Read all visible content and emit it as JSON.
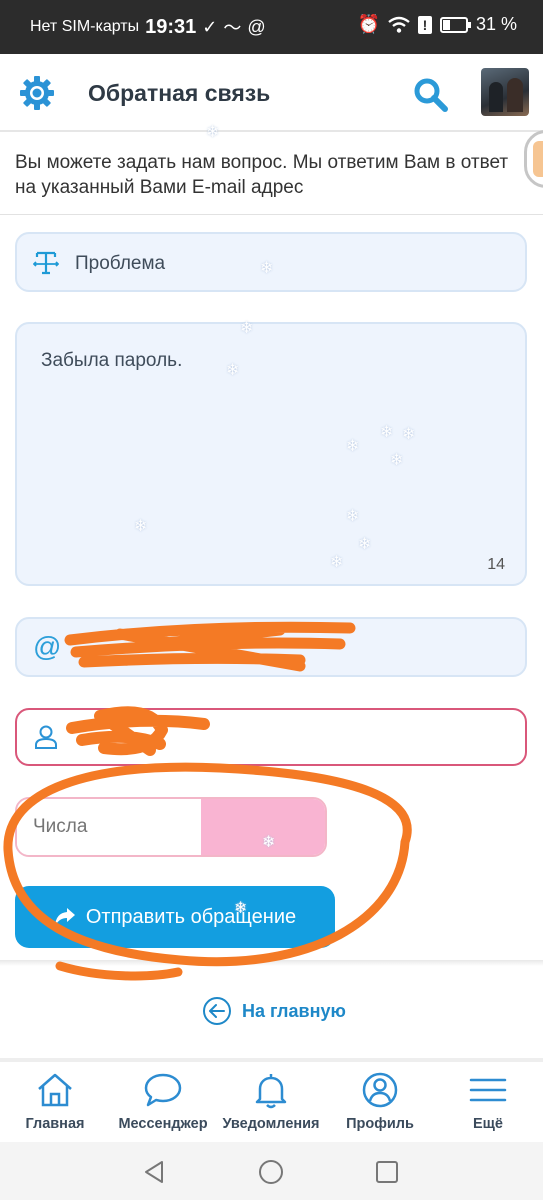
{
  "status_bar": {
    "carrier": "Нет SIM-карты",
    "time": "19:31",
    "indicators": [
      "check-icon",
      "tilde-icon",
      "at-icon"
    ],
    "right_icons": [
      "alarm-icon",
      "wifi-icon",
      "alert-icon"
    ],
    "battery": "31 %"
  },
  "header": {
    "title": "Обратная связь",
    "left_icon": "gear-icon",
    "search_icon": "search-icon",
    "avatar_icon": "avatar"
  },
  "intro": {
    "text": "Вы можете задать нам вопрос. Мы ответим Вам в ответ на указанный Вами E-mail адрес"
  },
  "form": {
    "subject": {
      "icon": "text-cursor-icon",
      "value": "Проблема"
    },
    "message": {
      "value": "Забыла пароль.",
      "count": "14"
    },
    "email": {
      "icon": "at-icon",
      "value": ""
    },
    "name": {
      "icon": "user-icon",
      "value": ""
    },
    "captcha": {
      "placeholder": "Числа"
    },
    "submit": {
      "label": "Отправить обращение",
      "icon": "share-arrow-icon"
    }
  },
  "home_link": {
    "label": "На главную",
    "icon": "arrow-left-circle-icon"
  },
  "bottom_nav": {
    "items": [
      {
        "label": "Главная",
        "icon": "home-icon"
      },
      {
        "label": "Мессенджер",
        "icon": "chat-bubble-icon"
      },
      {
        "label": "Уведомления",
        "icon": "bell-icon"
      },
      {
        "label": "Профиль",
        "icon": "profile-icon"
      },
      {
        "label": "Ещё",
        "icon": "menu-icon"
      }
    ]
  },
  "system_nav": {
    "buttons": [
      "back-triangle-icon",
      "home-circle-icon",
      "recents-square-icon"
    ]
  },
  "colors": {
    "accent": "#139ee0",
    "field_bg": "#eef4fd",
    "error_border": "#d9577a",
    "captcha_bg": "#f9b4d2",
    "scribble": "#f47a25"
  }
}
